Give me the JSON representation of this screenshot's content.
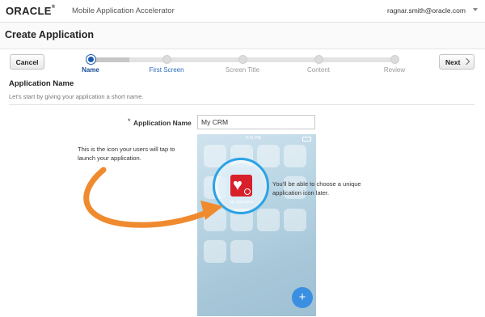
{
  "header": {
    "logo_text": "ORACLE",
    "logo_mark": "®",
    "app_name": "Mobile Application Accelerator",
    "user_email": "ragnar.smith@oracle.com"
  },
  "page": {
    "title": "Create Application"
  },
  "wizard": {
    "cancel_label": "Cancel",
    "next_label": "Next",
    "steps": [
      {
        "label": "Name",
        "state": "active"
      },
      {
        "label": "First Screen",
        "state": "link"
      },
      {
        "label": "Screen Title",
        "state": "pending"
      },
      {
        "label": "Content",
        "state": "pending"
      },
      {
        "label": "Review",
        "state": "pending"
      }
    ]
  },
  "section": {
    "title": "Application Name",
    "subtitle": "Let's start by giving your application a short name."
  },
  "form": {
    "required_mark": "*",
    "app_name_label": "Application Name",
    "app_name_value": "My CRM"
  },
  "preview": {
    "status_time": "9:41 PM",
    "app_icon_caption": "My Application",
    "fab_label": "+",
    "callout_left": "This is the icon your users will tap to launch your application.",
    "callout_right": "You'll be able to choose a unique application icon later."
  },
  "colors": {
    "accent": "#1a5bb0",
    "arrow": "#f08a2e",
    "focus_ring": "#29a3e6",
    "app_icon": "#d8202a"
  }
}
